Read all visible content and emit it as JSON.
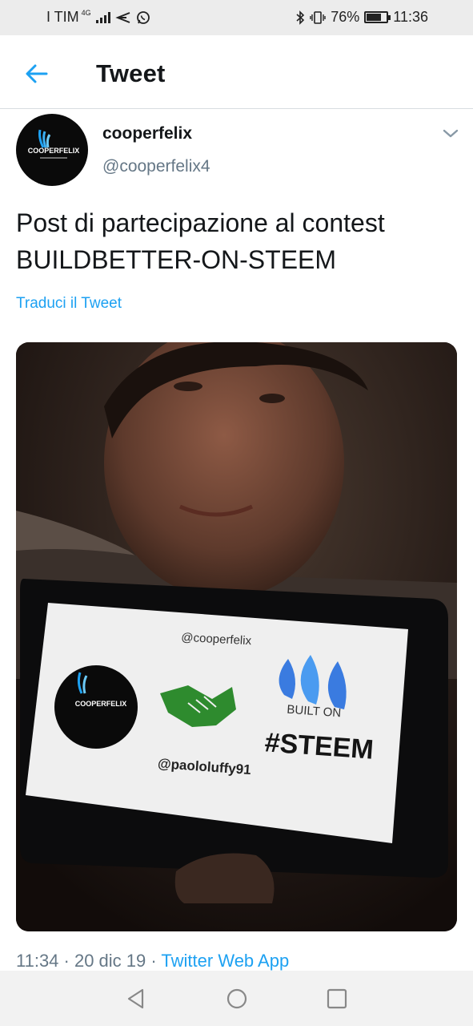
{
  "status_bar": {
    "carrier": "I TIM",
    "network": "4G",
    "battery": "76%",
    "battery_level": 0.76,
    "time": "11:36",
    "icons": [
      "signal-icon",
      "send-icon",
      "whatsapp-icon",
      "bluetooth-icon",
      "vibrate-icon",
      "battery-icon"
    ]
  },
  "header": {
    "back_icon": "arrow-left-icon",
    "title": "Tweet"
  },
  "tweet": {
    "author": {
      "display_name": "cooperfelix",
      "handle": "@cooperfelix4",
      "avatar_text": "COOPERFELIX"
    },
    "text_line1": "Post di partecipazione al contest",
    "text_line2": "BUILDBETTER-ON-STEEM",
    "translate_label": "Traduci il Tweet",
    "media": {
      "screen_handle_top": "@cooperfelix",
      "screen_logo_text": "COOPERFELIX",
      "screen_built_text": "BUILT ON",
      "screen_steem_text": "#STEEM",
      "screen_handle_bottom": "@paololuffy91"
    },
    "meta": {
      "time_date": "11:34 · 20 dic 19 · ",
      "source": "Twitter Web App"
    }
  },
  "colors": {
    "accent": "#1da1f2",
    "secondary_text": "#657786",
    "divider": "#d8dde1"
  },
  "nav_bar": {
    "icons": [
      "back-triangle-icon",
      "home-circle-icon",
      "recents-square-icon"
    ]
  }
}
